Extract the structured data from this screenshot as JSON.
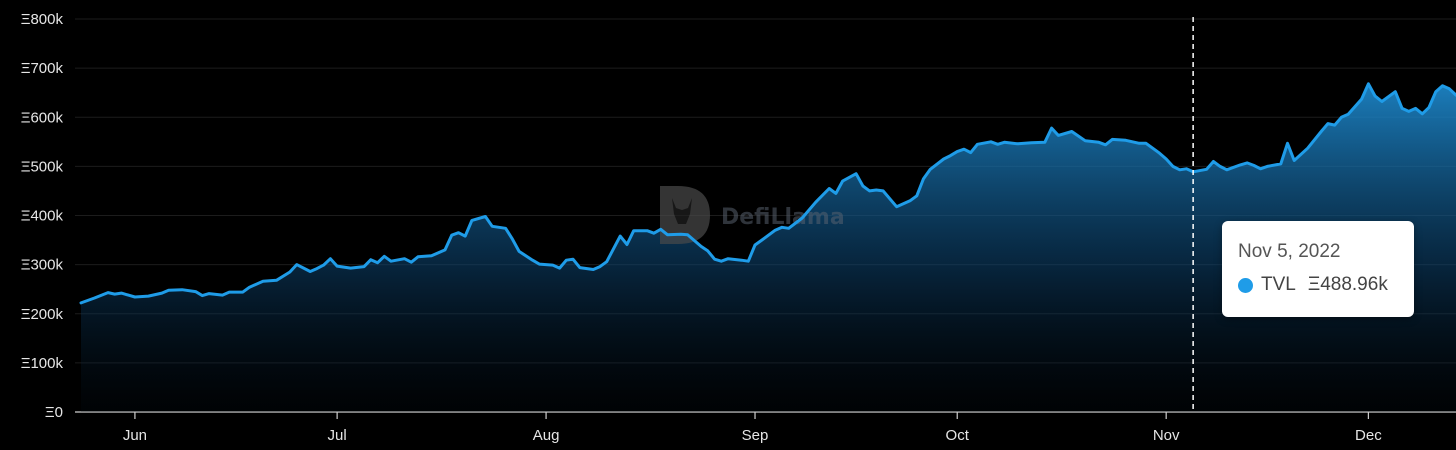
{
  "colors": {
    "line": "#1f9ce8",
    "background": "#000000",
    "grid": "#1c1c1c",
    "tooltip_bg": "#ffffff"
  },
  "watermark": {
    "text": "DefiLlama",
    "icon": "defillama-logo-icon"
  },
  "tooltip": {
    "date": "Nov 5, 2022",
    "series_label": "TVL",
    "value": "Ξ488.96k"
  },
  "chart_data": {
    "type": "area",
    "title": "",
    "xlabel": "",
    "ylabel": "",
    "ylim": [
      0,
      800000
    ],
    "xlim": [
      "2022-05-24",
      "2022-12-14"
    ],
    "grid": true,
    "legend": "none",
    "y_ticks": [
      {
        "value": 0,
        "label": "Ξ0"
      },
      {
        "value": 100000,
        "label": "Ξ100k"
      },
      {
        "value": 200000,
        "label": "Ξ200k"
      },
      {
        "value": 300000,
        "label": "Ξ300k"
      },
      {
        "value": 400000,
        "label": "Ξ400k"
      },
      {
        "value": 500000,
        "label": "Ξ500k"
      },
      {
        "value": 600000,
        "label": "Ξ600k"
      },
      {
        "value": 700000,
        "label": "Ξ700k"
      },
      {
        "value": 800000,
        "label": "Ξ800k"
      }
    ],
    "x_ticks": [
      {
        "date": "2022-06-01",
        "label": "Jun"
      },
      {
        "date": "2022-07-01",
        "label": "Jul"
      },
      {
        "date": "2022-08-01",
        "label": "Aug"
      },
      {
        "date": "2022-09-01",
        "label": "Sep"
      },
      {
        "date": "2022-10-01",
        "label": "Oct"
      },
      {
        "date": "2022-11-01",
        "label": "Nov"
      },
      {
        "date": "2022-12-01",
        "label": "Dec"
      }
    ],
    "highlight_date": "2022-11-05",
    "series": [
      {
        "name": "TVL",
        "points": [
          [
            "2022-05-24",
            222000
          ],
          [
            "2022-05-26",
            232000
          ],
          [
            "2022-05-28",
            243000
          ],
          [
            "2022-05-29",
            240000
          ],
          [
            "2022-05-30",
            242000
          ],
          [
            "2022-06-01",
            234000
          ],
          [
            "2022-06-03",
            236000
          ],
          [
            "2022-06-05",
            242000
          ],
          [
            "2022-06-06",
            248000
          ],
          [
            "2022-06-08",
            249000
          ],
          [
            "2022-06-10",
            245000
          ],
          [
            "2022-06-11",
            237000
          ],
          [
            "2022-06-12",
            241000
          ],
          [
            "2022-06-14",
            238000
          ],
          [
            "2022-06-15",
            244000
          ],
          [
            "2022-06-17",
            244000
          ],
          [
            "2022-06-18",
            254000
          ],
          [
            "2022-06-20",
            266000
          ],
          [
            "2022-06-22",
            268000
          ],
          [
            "2022-06-24",
            285000
          ],
          [
            "2022-06-25",
            300000
          ],
          [
            "2022-06-27",
            286000
          ],
          [
            "2022-06-28",
            292000
          ],
          [
            "2022-06-29",
            299000
          ],
          [
            "2022-06-30",
            312000
          ],
          [
            "2022-07-01",
            297000
          ],
          [
            "2022-07-03",
            293000
          ],
          [
            "2022-07-05",
            296000
          ],
          [
            "2022-07-06",
            310000
          ],
          [
            "2022-07-07",
            304000
          ],
          [
            "2022-07-08",
            317000
          ],
          [
            "2022-07-09",
            307000
          ],
          [
            "2022-07-11",
            312000
          ],
          [
            "2022-07-12",
            305000
          ],
          [
            "2022-07-13",
            316000
          ],
          [
            "2022-07-15",
            318000
          ],
          [
            "2022-07-17",
            330000
          ],
          [
            "2022-07-18",
            360000
          ],
          [
            "2022-07-19",
            365000
          ],
          [
            "2022-07-20",
            358000
          ],
          [
            "2022-07-21",
            390000
          ],
          [
            "2022-07-23",
            398000
          ],
          [
            "2022-07-24",
            378000
          ],
          [
            "2022-07-26",
            374000
          ],
          [
            "2022-07-27",
            352000
          ],
          [
            "2022-07-28",
            327000
          ],
          [
            "2022-07-30",
            309000
          ],
          [
            "2022-07-31",
            301000
          ],
          [
            "2022-08-02",
            299000
          ],
          [
            "2022-08-03",
            293000
          ],
          [
            "2022-08-04",
            309000
          ],
          [
            "2022-08-05",
            311000
          ],
          [
            "2022-08-06",
            294000
          ],
          [
            "2022-08-08",
            290000
          ],
          [
            "2022-08-09",
            296000
          ],
          [
            "2022-08-10",
            306000
          ],
          [
            "2022-08-12",
            358000
          ],
          [
            "2022-08-13",
            341000
          ],
          [
            "2022-08-14",
            369000
          ],
          [
            "2022-08-16",
            369000
          ],
          [
            "2022-08-17",
            364000
          ],
          [
            "2022-08-18",
            372000
          ],
          [
            "2022-08-19",
            361000
          ],
          [
            "2022-08-21",
            362000
          ],
          [
            "2022-08-22",
            361000
          ],
          [
            "2022-08-24",
            337000
          ],
          [
            "2022-08-25",
            328000
          ],
          [
            "2022-08-26",
            311000
          ],
          [
            "2022-08-27",
            307000
          ],
          [
            "2022-08-28",
            312000
          ],
          [
            "2022-08-30",
            309000
          ],
          [
            "2022-08-31",
            307000
          ],
          [
            "2022-09-01",
            340000
          ],
          [
            "2022-09-02",
            350000
          ],
          [
            "2022-09-04",
            370000
          ],
          [
            "2022-09-05",
            376000
          ],
          [
            "2022-09-06",
            374000
          ],
          [
            "2022-09-08",
            395000
          ],
          [
            "2022-09-10",
            427000
          ],
          [
            "2022-09-12",
            455000
          ],
          [
            "2022-09-13",
            445000
          ],
          [
            "2022-09-14",
            470000
          ],
          [
            "2022-09-16",
            485000
          ],
          [
            "2022-09-17",
            460000
          ],
          [
            "2022-09-18",
            450000
          ],
          [
            "2022-09-19",
            452000
          ],
          [
            "2022-09-20",
            450000
          ],
          [
            "2022-09-22",
            418000
          ],
          [
            "2022-09-24",
            430000
          ],
          [
            "2022-09-25",
            440000
          ],
          [
            "2022-09-26",
            475000
          ],
          [
            "2022-09-27",
            494000
          ],
          [
            "2022-09-29",
            515000
          ],
          [
            "2022-09-30",
            522000
          ],
          [
            "2022-10-01",
            530000
          ],
          [
            "2022-10-02",
            535000
          ],
          [
            "2022-10-03",
            528000
          ],
          [
            "2022-10-04",
            545000
          ],
          [
            "2022-10-06",
            550000
          ],
          [
            "2022-10-07",
            545000
          ],
          [
            "2022-10-08",
            549000
          ],
          [
            "2022-10-10",
            546000
          ],
          [
            "2022-10-12",
            548000
          ],
          [
            "2022-10-14",
            549000
          ],
          [
            "2022-10-15",
            578000
          ],
          [
            "2022-10-16",
            563000
          ],
          [
            "2022-10-18",
            571000
          ],
          [
            "2022-10-20",
            552000
          ],
          [
            "2022-10-22",
            549000
          ],
          [
            "2022-10-23",
            544000
          ],
          [
            "2022-10-24",
            555000
          ],
          [
            "2022-10-26",
            553000
          ],
          [
            "2022-10-28",
            547000
          ],
          [
            "2022-10-29",
            547000
          ],
          [
            "2022-10-30",
            537000
          ],
          [
            "2022-10-31",
            527000
          ],
          [
            "2022-11-01",
            515000
          ],
          [
            "2022-11-02",
            500000
          ],
          [
            "2022-11-03",
            493000
          ],
          [
            "2022-11-04",
            495000
          ],
          [
            "2022-11-05",
            488960
          ],
          [
            "2022-11-07",
            494000
          ],
          [
            "2022-11-08",
            510000
          ],
          [
            "2022-11-09",
            500000
          ],
          [
            "2022-11-10",
            493000
          ],
          [
            "2022-11-12",
            503000
          ],
          [
            "2022-11-13",
            507000
          ],
          [
            "2022-11-14",
            502000
          ],
          [
            "2022-11-15",
            495000
          ],
          [
            "2022-11-16",
            500000
          ],
          [
            "2022-11-18",
            505000
          ],
          [
            "2022-11-19",
            547000
          ],
          [
            "2022-11-20",
            512000
          ],
          [
            "2022-11-22",
            537000
          ],
          [
            "2022-11-24",
            571000
          ],
          [
            "2022-11-25",
            587000
          ],
          [
            "2022-11-26",
            584000
          ],
          [
            "2022-11-27",
            600000
          ],
          [
            "2022-11-28",
            606000
          ],
          [
            "2022-11-30",
            637000
          ],
          [
            "2022-12-01",
            668000
          ],
          [
            "2022-12-02",
            643000
          ],
          [
            "2022-12-03",
            632000
          ],
          [
            "2022-12-05",
            652000
          ],
          [
            "2022-12-06",
            618000
          ],
          [
            "2022-12-07",
            612000
          ],
          [
            "2022-12-08",
            618000
          ],
          [
            "2022-12-09",
            607000
          ],
          [
            "2022-12-10",
            620000
          ],
          [
            "2022-12-11",
            652000
          ],
          [
            "2022-12-12",
            664000
          ],
          [
            "2022-12-13",
            658000
          ],
          [
            "2022-12-14",
            645000
          ]
        ]
      }
    ]
  }
}
